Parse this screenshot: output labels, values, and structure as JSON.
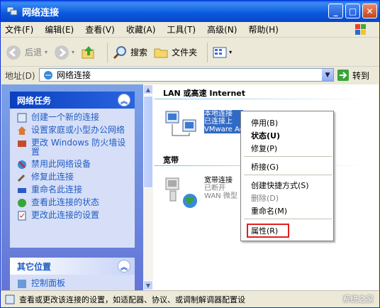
{
  "window": {
    "title": "网络连接"
  },
  "menu": [
    "文件(F)",
    "编辑(E)",
    "查看(V)",
    "收藏(A)",
    "工具(T)",
    "高级(N)",
    "帮助(H)"
  ],
  "toolbar": {
    "back": "后退",
    "search": "搜索",
    "folders": "文件夹"
  },
  "address": {
    "label": "地址(D)",
    "value": "网络连接",
    "go": "转到"
  },
  "tasks": {
    "title": "网络任务",
    "items": [
      "创建一个新的连接",
      "设置家庭或小型办公网络",
      "更改 Windows 防火墙设置",
      "禁用此网络设备",
      "修复此连接",
      "重命名此连接",
      "查看此连接的状态",
      "更改此连接的设置"
    ]
  },
  "other": {
    "title": "其它位置",
    "first": "控制面板"
  },
  "groups": {
    "lan": "LAN 或高速 Internet",
    "broadband": "宽带"
  },
  "lan_conn": {
    "name": "本地连接",
    "status": "已连接上",
    "device": "VMware Ac"
  },
  "bb_conn": {
    "name": "宽带连接",
    "status": "已断开",
    "device": "WAN 微型"
  },
  "context_menu": {
    "items": [
      "停用(B)",
      "状态(U)",
      "修复(P)",
      "桥接(G)",
      "创建快捷方式(S)",
      "删除(D)",
      "重命名(M)",
      "属性(R)"
    ]
  },
  "statusbar": "查看或更改该连接的设置，如适配器、协议、或调制解调器配置设",
  "watermark": "系统之家"
}
